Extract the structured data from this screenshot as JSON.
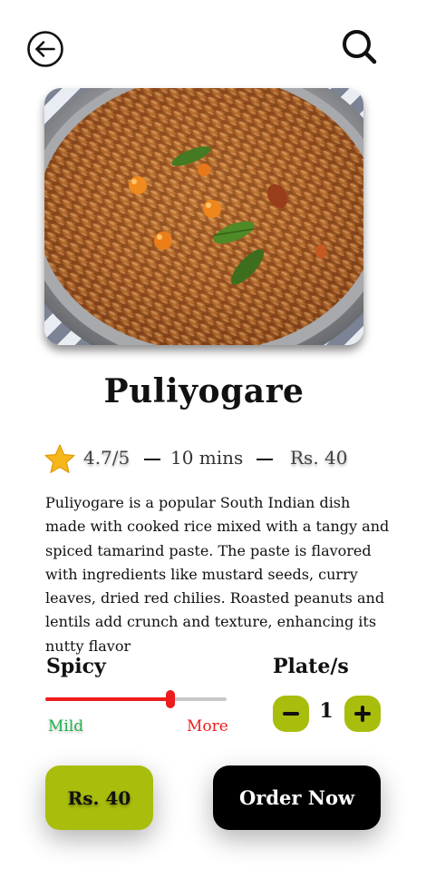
{
  "header": {
    "back_icon": "arrow-left-circle-icon",
    "search_icon": "search-icon"
  },
  "dish": {
    "image_alt": "",
    "name": "Puliyogare",
    "rating": "4.7/5",
    "time": "10 mins",
    "price": "Rs. 40",
    "description": "Puliyogare is a popular South Indian dish made with cooked rice mixed with a tangy and spiced tamarind paste. The paste is flavored with ingredients like mustard seeds, curry leaves, dried red chilies. Roasted peanuts and lentils add crunch and texture, enhancing its nutty flavor"
  },
  "spice": {
    "label": "Spicy",
    "min_label": "Mild",
    "max_label": "More",
    "level": 0.69,
    "colors": {
      "fill": "#ee1c1c",
      "track": "#c8c8c8",
      "mild": "#22b24c",
      "more": "#ee1c1c"
    }
  },
  "plates": {
    "label": "Plate/s",
    "quantity": "1",
    "minus_icon": "minus-icon",
    "plus_icon": "plus-icon"
  },
  "actions": {
    "price_label": "Rs. 40",
    "order_label": "Order Now"
  },
  "colors": {
    "accent": "#a9bd0d",
    "primary_button": "#000000",
    "star": "#f5b719"
  }
}
